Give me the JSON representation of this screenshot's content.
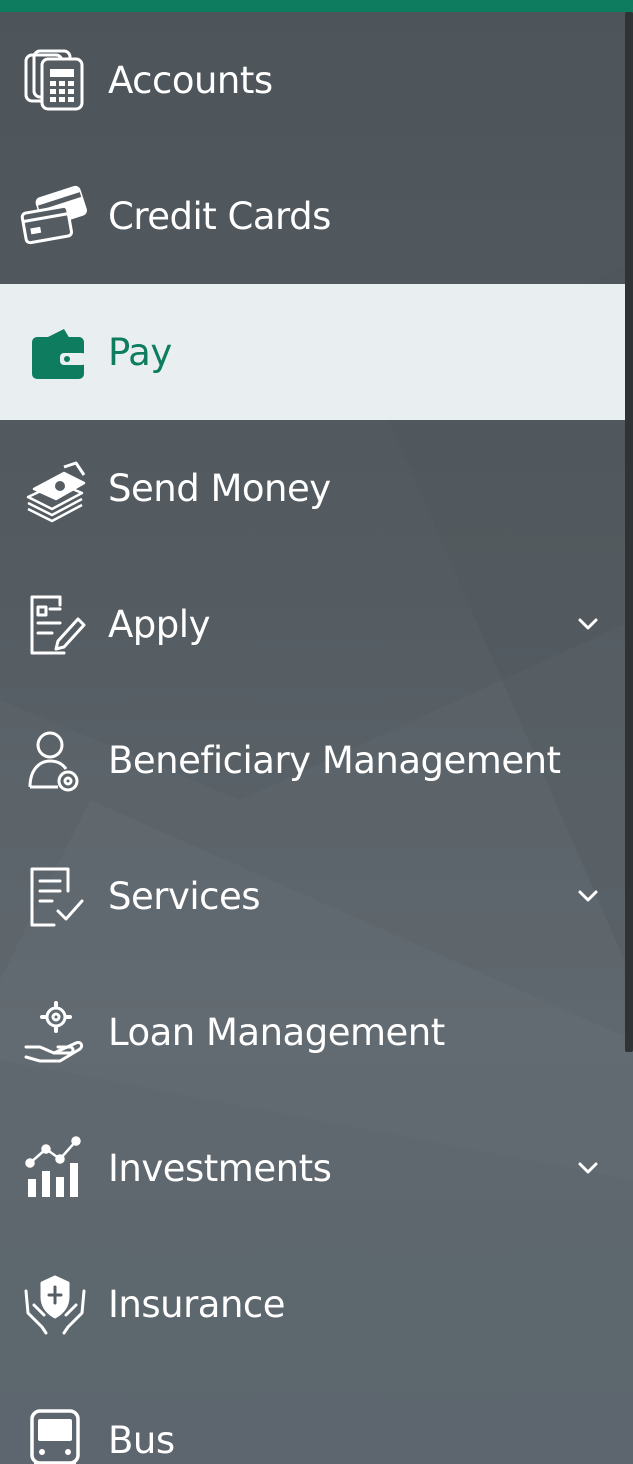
{
  "colors": {
    "accent": "#0e7c5e",
    "active_bg": "#e9eef0",
    "sidebar_bg": "#555d63",
    "text": "#ffffff"
  },
  "menu": {
    "items": [
      {
        "id": "accounts",
        "label": "Accounts",
        "icon": "accounts-icon",
        "active": false,
        "has_submenu": false
      },
      {
        "id": "credit-cards",
        "label": "Credit Cards",
        "icon": "credit-cards-icon",
        "active": false,
        "has_submenu": false
      },
      {
        "id": "pay",
        "label": "Pay",
        "icon": "wallet-icon",
        "active": true,
        "has_submenu": false
      },
      {
        "id": "send-money",
        "label": "Send Money",
        "icon": "money-stack-icon",
        "active": false,
        "has_submenu": false
      },
      {
        "id": "apply",
        "label": "Apply",
        "icon": "form-edit-icon",
        "active": false,
        "has_submenu": true
      },
      {
        "id": "beneficiary-management",
        "label": "Beneficiary Management",
        "icon": "user-settings-icon",
        "active": false,
        "has_submenu": false
      },
      {
        "id": "services",
        "label": "Services",
        "icon": "checklist-icon",
        "active": false,
        "has_submenu": true
      },
      {
        "id": "loan-management",
        "label": "Loan Management",
        "icon": "hand-gear-icon",
        "active": false,
        "has_submenu": false
      },
      {
        "id": "investments",
        "label": "Investments",
        "icon": "investment-chart-icon",
        "active": false,
        "has_submenu": true
      },
      {
        "id": "insurance",
        "label": "Insurance",
        "icon": "shield-hands-icon",
        "active": false,
        "has_submenu": false
      },
      {
        "id": "bus",
        "label": "Bus",
        "icon": "bus-icon",
        "active": false,
        "has_submenu": false
      }
    ]
  }
}
